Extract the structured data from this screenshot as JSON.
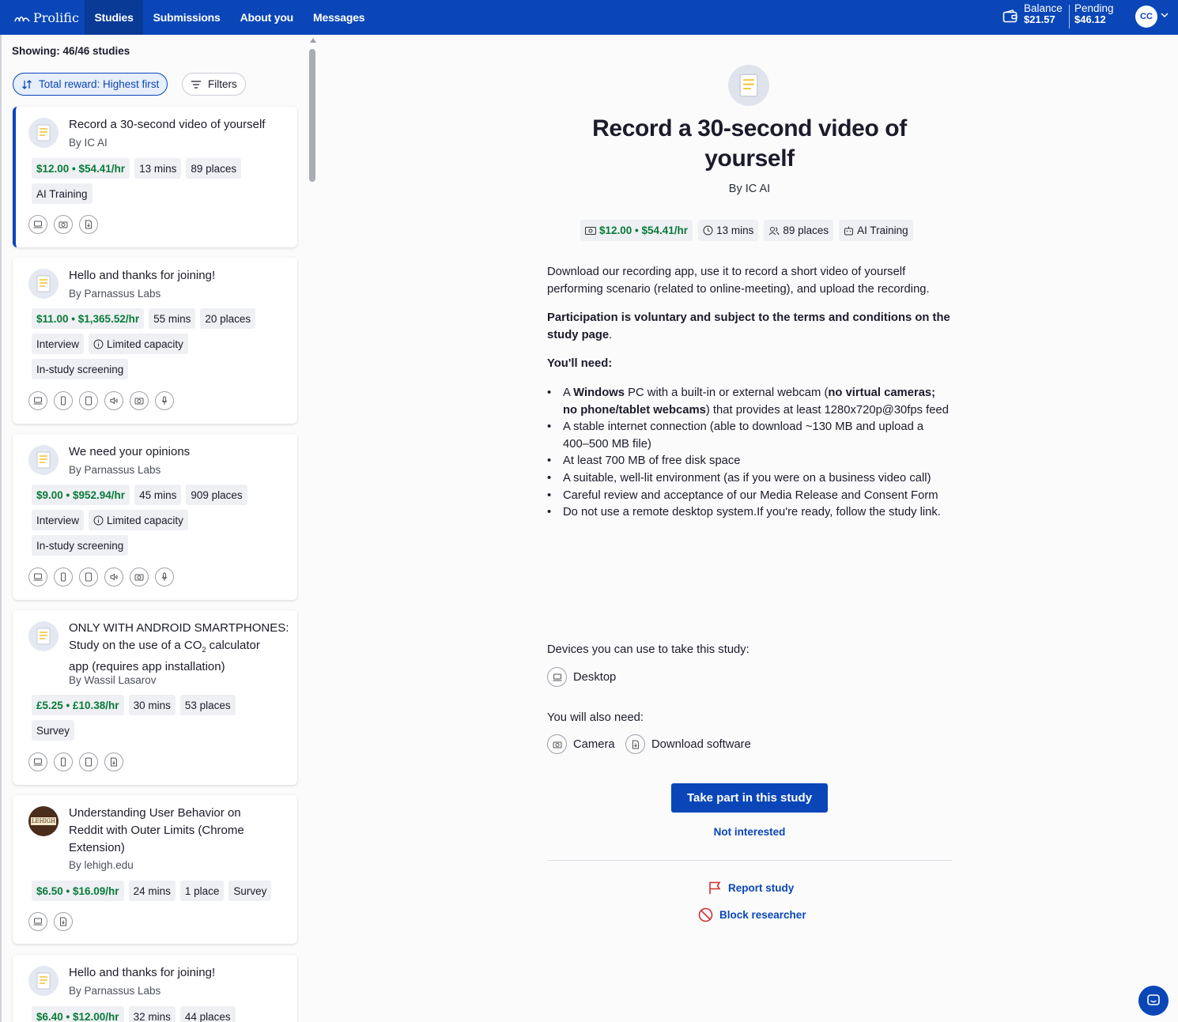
{
  "nav": {
    "logo": "Prolific",
    "items": [
      "Studies",
      "Submissions",
      "About you",
      "Messages"
    ],
    "balance_label": "Balance",
    "balance_value": "$21.57",
    "pending_label": "Pending",
    "pending_value": "$46.12",
    "avatar_initials": "CC"
  },
  "list": {
    "showing": "Showing: 46/46 studies",
    "sort_label": "Total reward: Highest first",
    "filters_label": "Filters",
    "studies": [
      {
        "title": "Record a 30-second video of yourself",
        "by": "By IC AI",
        "reward": "$12.00 • $54.41/hr",
        "duration": "13 mins",
        "places": "89 places",
        "tags": [
          "AI Training"
        ]
      },
      {
        "title": "Hello and thanks for joining!",
        "by": "By Parnassus Labs",
        "reward": "$11.00 • $1,365.52/hr",
        "duration": "55 mins",
        "places": "20 places",
        "tags": [
          "Interview",
          "Limited capacity",
          "In-study screening"
        ]
      },
      {
        "title": "We need your opinions",
        "by": "By Parnassus Labs",
        "reward": "$9.00 • $952.94/hr",
        "duration": "45 mins",
        "places": "909 places",
        "tags": [
          "Interview",
          "Limited capacity",
          "In-study screening"
        ]
      },
      {
        "title_line1": "ONLY WITH ANDROID SMARTPHONES:",
        "title_line2_pre": "Study on the use of a CO",
        "title_line2_sub": "2",
        "title_line2_post": " calculator",
        "title_line3": "app (requires app installation)",
        "by": "By Wassil Lasarov",
        "reward": "£5.25 • £10.38/hr",
        "duration": "30 mins",
        "places": "53 places",
        "tags": [
          "Survey"
        ]
      },
      {
        "title": "Understanding User Behavior on Reddit with Outer Limits (Chrome Extension)",
        "by": "By lehigh.edu",
        "logo_text": "LEHIGH",
        "reward": "$6.50 • $16.09/hr",
        "duration": "24 mins",
        "places": "1 place",
        "tags": [
          "Survey"
        ]
      },
      {
        "title": "Hello and thanks for joining!",
        "by": "By Parnassus Labs",
        "reward": "$6.40 • $12.00/hr",
        "duration": "32 mins",
        "places": "44 places",
        "tags": []
      }
    ]
  },
  "detail": {
    "title": "Record a 30-second video of yourself",
    "by": "By IC AI",
    "reward": "$12.00 • $54.41/hr",
    "duration": "13 mins",
    "places": "89 places",
    "category": "AI Training",
    "intro": "Download our recording app, use it to record a short video of yourself performing scenario (related to online-meeting), and upload the recording.",
    "participation_bold": "Participation is voluntary and subject to the terms and conditions on the study page",
    "participation_end": ".",
    "need_heading": "You'll need:",
    "bullet1_a": "A ",
    "bullet1_b": "Windows",
    "bullet1_c": " PC with a built-in or external webcam (",
    "bullet1_d": "no virtual cameras; no phone/tablet webcams",
    "bullet1_e": ") that provides at least 1280x720p@30fps feed",
    "bullet2": "A stable internet connection (able to download ~130 MB and upload a 400–500 MB file)",
    "bullet3": "At least 700 MB of free disk space",
    "bullet4": "A suitable, well-lit environment (as if you were on a business video call)",
    "bullet5": "Careful review and acceptance of our Media Release and Consent Form",
    "bullet6": "Do not use a remote desktop system.If you're ready, follow the study link.",
    "devices_label": "Devices you can use to take this study:",
    "device_desktop": "Desktop",
    "also_need_label": "You will also need:",
    "need_camera": "Camera",
    "need_software": "Download software",
    "take_part": "Take part in this study",
    "not_interested": "Not interested",
    "report": "Report study",
    "block": "Block researcher"
  },
  "colors": {
    "brand": "#0a46b7",
    "reward_green": "#097a3b",
    "danger": "#d32f2f"
  }
}
